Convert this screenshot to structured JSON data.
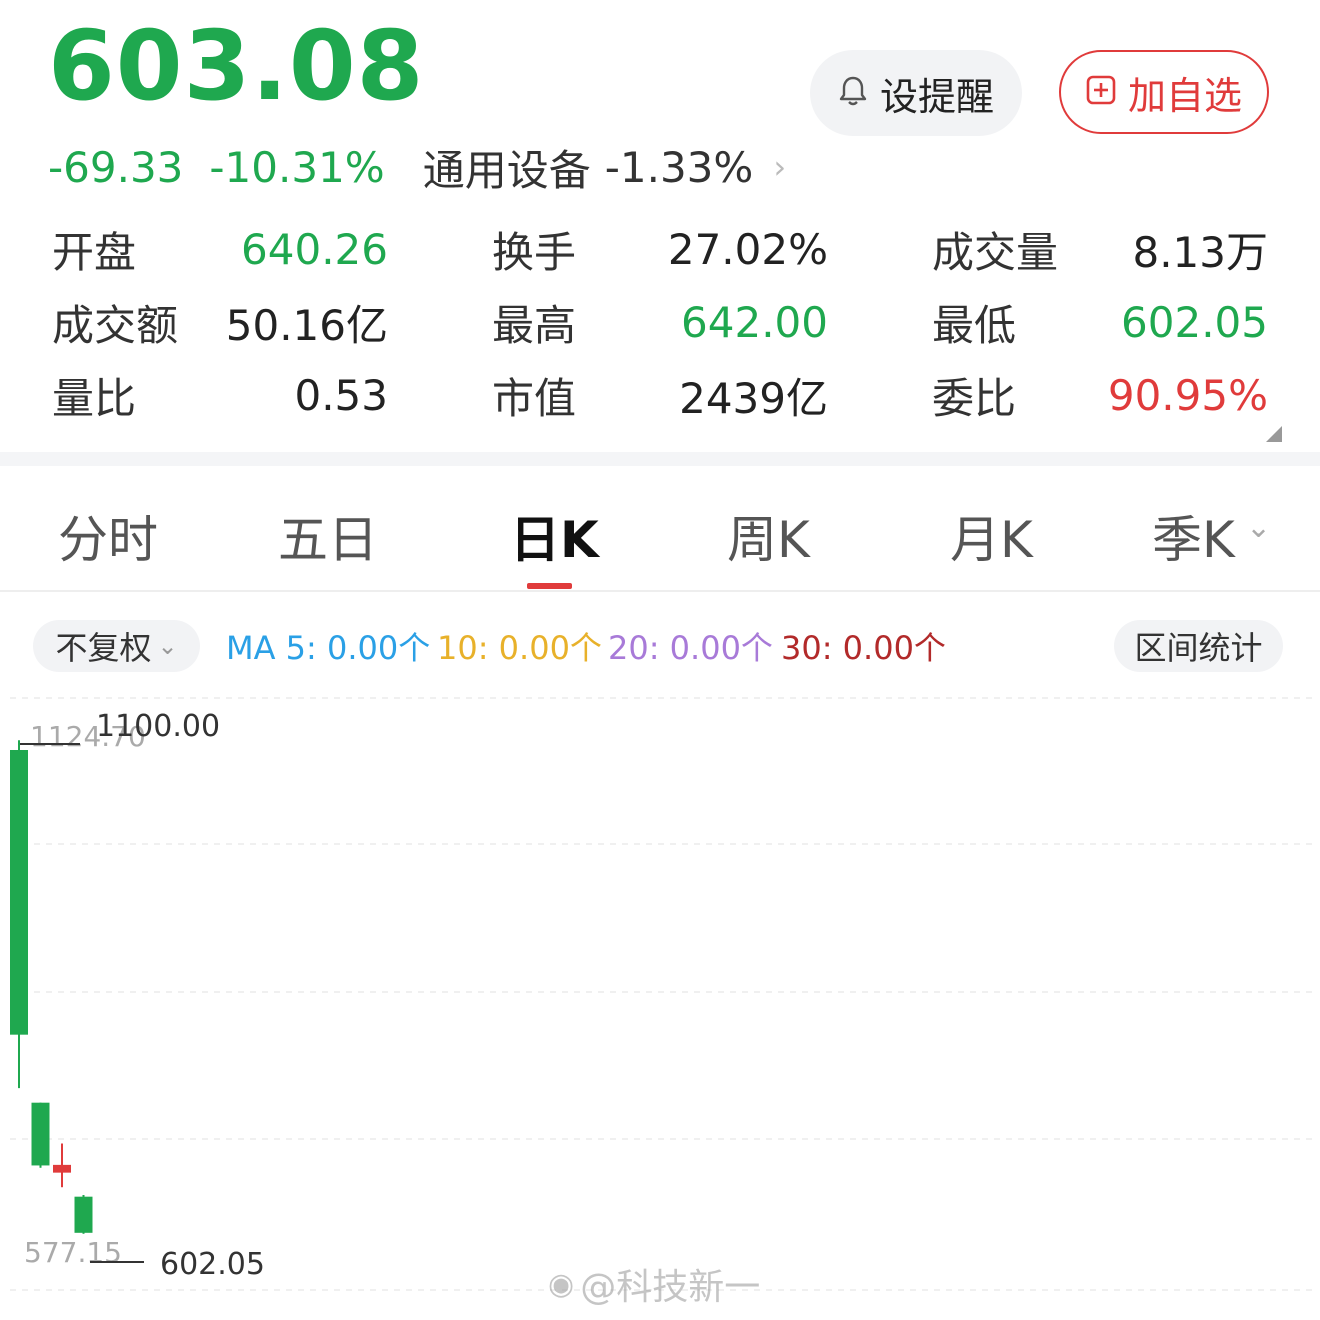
{
  "quote": {
    "price": "603.08",
    "change": "-69.33",
    "change_pct": "-10.31%",
    "sector_name": "通用设备",
    "sector_change": "-1.33%"
  },
  "buttons": {
    "remind": "设提醒",
    "favorite": "加自选"
  },
  "stats": [
    [
      {
        "k": "开盘",
        "v": "640.26",
        "color": "#1fa84f"
      },
      {
        "k": "换手",
        "v": "27.02%",
        "color": "#222222"
      },
      {
        "k": "成交量",
        "v": "8.13万",
        "color": "#222222"
      }
    ],
    [
      {
        "k": "成交额",
        "v": "50.16亿",
        "color": "#222222"
      },
      {
        "k": "最高",
        "v": "642.00",
        "color": "#1fa84f"
      },
      {
        "k": "最低",
        "v": "602.05",
        "color": "#1fa84f"
      }
    ],
    [
      {
        "k": "量比",
        "v": "0.53",
        "color": "#222222"
      },
      {
        "k": "市值",
        "v": "2439亿",
        "color": "#222222"
      },
      {
        "k": "委比",
        "v": "90.95%",
        "color": "#e03b3b"
      }
    ]
  ],
  "tabs": [
    "分时",
    "五日",
    "日K",
    "周K",
    "月K",
    "季K"
  ],
  "active_tab": "日K",
  "adjust_label": "不复权",
  "ma": [
    {
      "label": "MA 5: 0.00个",
      "color": "#2aa0e6"
    },
    {
      "label": "10: 0.00个",
      "color": "#e8b12a"
    },
    {
      "label": "20: 0.00个",
      "color": "#a87ad8"
    },
    {
      "label": "30: 0.00个",
      "color": "#b22a2a"
    }
  ],
  "range_stats_label": "区间统计",
  "watermark": "@科技新一",
  "chart_data": {
    "type": "candlestick",
    "y_labels": {
      "top_left": "1124.70",
      "top_marker": "1100.00",
      "bottom_left": "577.15",
      "bottom_marker": "602.05"
    },
    "candles": [
      {
        "open": 1100.0,
        "close": 807.0,
        "high": 1110.0,
        "low": 752.0,
        "direction": "down"
      },
      {
        "open": 737.0,
        "close": 672.41,
        "high": 737.0,
        "low": 670.0,
        "direction": "down"
      },
      {
        "open": 665.0,
        "close": 673.0,
        "high": 695.0,
        "low": 650.0,
        "direction": "up"
      },
      {
        "open": 640.26,
        "close": 603.08,
        "high": 642.0,
        "low": 602.05,
        "direction": "down"
      }
    ],
    "colors": {
      "up": "#e03b3b",
      "down": "#1fa84f"
    },
    "grid": true
  }
}
